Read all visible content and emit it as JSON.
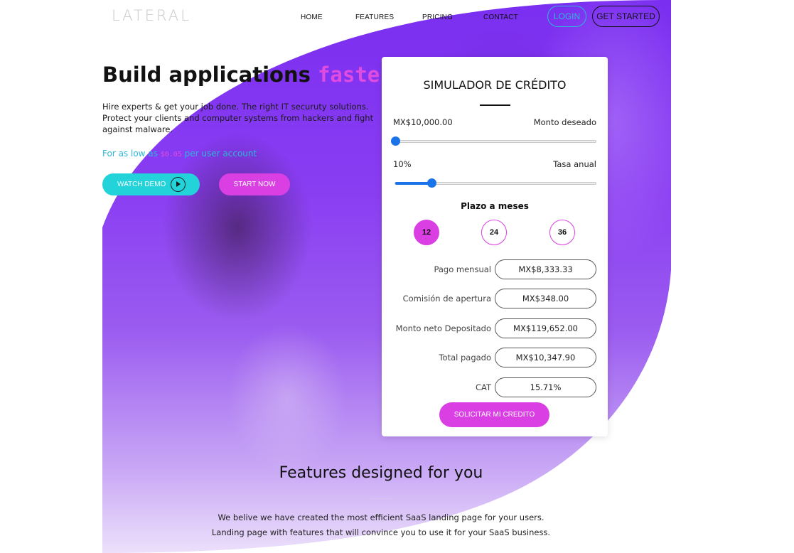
{
  "nav": {
    "logo": "LATERAL",
    "links": [
      "HOME",
      "FEATURES",
      "PRICING",
      "CONTACT"
    ],
    "login_label": "LOGIN",
    "get_started_label": "GET STARTED"
  },
  "hero": {
    "title_main": "Build applications",
    "title_accent": "faster",
    "description": "Hire experts & get your job done. The right IT securuty solutions. Protect your clients and computer systems from hackers and fight against malware.",
    "price_prefix": "For as low as",
    "price_value": "$0.05",
    "price_suffix": "per user account",
    "watch_demo_label": "WATCH DEMO",
    "start_now_label": "START NOW"
  },
  "simulator": {
    "title": "SIMULADOR DE CRÉDITO",
    "amount_value": "MX$10,000.00",
    "amount_label": "Monto deseado",
    "amount_slider_fraction": 0.0,
    "rate_value": "10%",
    "rate_label": "Tasa anual",
    "rate_slider_fraction": 0.18,
    "term_title": "Plazo a meses",
    "terms": [
      "12",
      "24",
      "36"
    ],
    "selected_term": "12",
    "results": [
      {
        "label": "Pago mensual",
        "value": "MX$8,333.33"
      },
      {
        "label": "Comisión de apertura",
        "value": "MX$348.00"
      },
      {
        "label": "Monto neto Depositado",
        "value": "MX$119,652.00"
      },
      {
        "label": "Total pagado",
        "value": "MX$10,347.90"
      },
      {
        "label": "CAT",
        "value": "15.71%"
      }
    ],
    "submit_label": "SOLICITAR MI CREDITO"
  },
  "features": {
    "title": "Features designed for you",
    "description": "We belive we have created the most efficient SaaS landing page for your users. Landing page with features that will convince you to use it for your SaaS business."
  },
  "colors": {
    "accent_magenta": "#d93fe2",
    "accent_cyan": "#22d3d9",
    "slider_blue": "#1a73e8",
    "hero_purple": "#7a2ef0"
  }
}
